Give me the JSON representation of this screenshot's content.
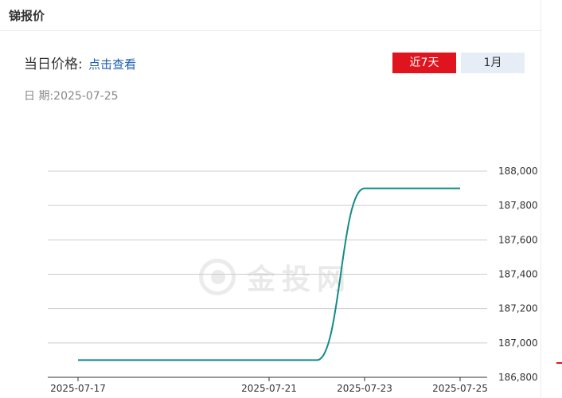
{
  "panel": {
    "title": "锑报价",
    "price_label": "当日价格:",
    "price_link": "点击查看",
    "date_label": "日 期:",
    "date_value": "2025-07-25",
    "btn_7d": "近7天",
    "btn_1m": "1月",
    "watermark": "金投网"
  },
  "colors": {
    "line": "#138a87",
    "active_button": "#e0141e",
    "inactive_button": "#e6edf6"
  },
  "chart_data": {
    "type": "line",
    "title": "",
    "xlabel": "",
    "ylabel": "",
    "x": [
      "2025-07-17",
      "2025-07-21",
      "2025-07-22",
      "2025-07-23",
      "2025-07-25"
    ],
    "x_tick_labels": [
      "2025-07-17",
      "2025-07-21",
      "2025-07-23",
      "2025-07-25"
    ],
    "y_tick_labels": [
      "186,800",
      "187,000",
      "187,200",
      "187,400",
      "187,600",
      "187,800",
      "188,000"
    ],
    "ylim": [
      186800,
      188000
    ],
    "grid": true,
    "series": [
      {
        "values": [
          186900,
          186900,
          186900,
          187900,
          187900
        ]
      }
    ]
  }
}
